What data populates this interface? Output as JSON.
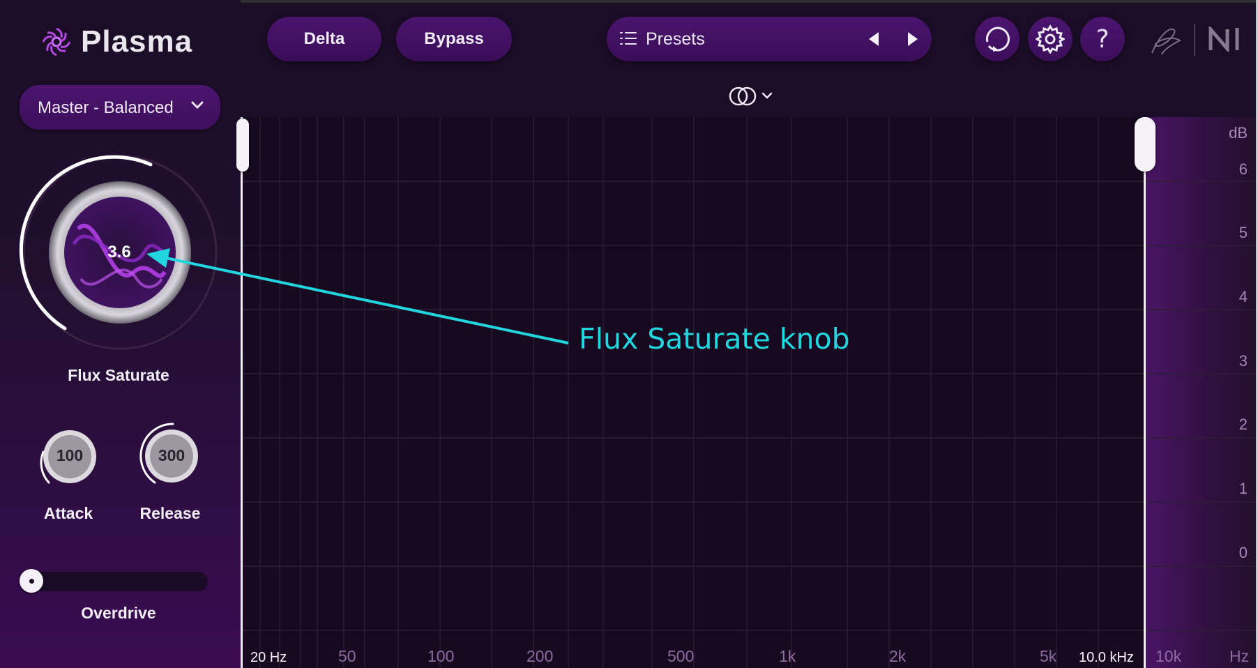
{
  "app": {
    "name": "Plasma"
  },
  "header": {
    "delta_label": "Delta",
    "bypass_label": "Bypass",
    "presets_label": "Presets",
    "help_glyph": "?"
  },
  "sidebar": {
    "preset_dropdown": "Master - Balanced",
    "flux": {
      "value": "3.6",
      "label": "Flux Saturate"
    },
    "attack": {
      "value": "100",
      "label": "Attack"
    },
    "release": {
      "value": "300",
      "label": "Release"
    },
    "overdrive": {
      "label": "Overdrive"
    }
  },
  "graph": {
    "db_unit": "dB",
    "db_ticks": [
      "6",
      "5",
      "4",
      "3",
      "2",
      "1",
      "0"
    ],
    "hz_ticks": [
      "50",
      "100",
      "200",
      "500",
      "1k",
      "2k",
      "5k",
      "10k"
    ],
    "hz_start": "20 Hz",
    "hz_cursor": "10.0 kHz",
    "hz_unit": "Hz"
  },
  "annotation": {
    "text": "Flux Saturate knob"
  },
  "colors": {
    "accent": "#4a146e",
    "annotation": "#22d6e0",
    "background": "#1b0d26"
  }
}
